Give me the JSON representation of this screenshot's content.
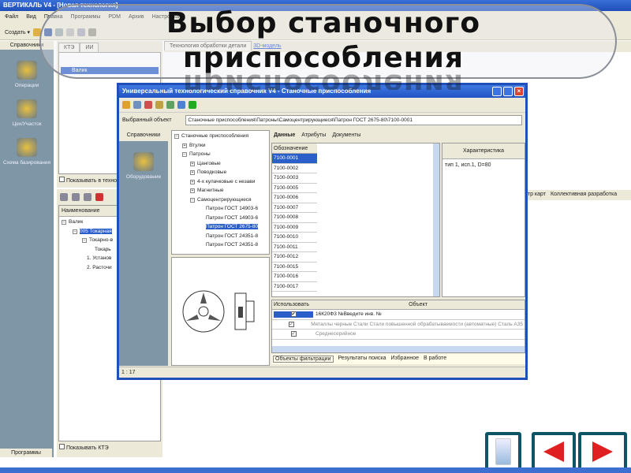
{
  "slide": {
    "title_line1": "Выбор станочного",
    "title_line2": "приспособления"
  },
  "app": {
    "title": "ВЕРТИКАЛЬ V4 - [Новая технология]",
    "menu": [
      "Файл",
      "Вид",
      "Правка",
      "Программы",
      "PDM",
      "Архив",
      "Настройка"
    ],
    "create_label": "Создать",
    "left_header": "Справочники",
    "left_items": [
      "Операции",
      "Цех/Участок",
      "Схема базирования"
    ],
    "left_footer": "Программы",
    "tabs": [
      "КТЭ",
      "ИИ"
    ],
    "tree_root": "Валик",
    "show_in_tech": "Показывать в техно",
    "main_tabs": [
      "Технология обработки детали",
      "3D-модель"
    ],
    "bottom_tabs": [
      "Просмотр карт",
      "Коллективная разработка"
    ],
    "lower_header": "Наименование",
    "lower_tree": [
      "Валик",
      "005 Токарная",
      "Токарно-в",
      "Токарь",
      "1. Установ",
      "2. Расточи"
    ],
    "show_kte": "Показывать КТЭ"
  },
  "dialog": {
    "title": "Универсальный технологический справочник V4 - Станочные приспособления",
    "selected_label": "Выбранный объект",
    "selected_value": "Станочные приспособления\\Патроны\\Самоцентрирующиеся\\Патрон ГОСТ 2675-80\\7100-0001",
    "sidebar_header": "Справочники",
    "sidebar_item": "Оборудование",
    "tree": [
      "Станочные приспособления",
      "Втулки",
      "Патроны",
      "Цанговые",
      "Поводковые",
      "4-х кулачковые с незави",
      "Магнитные",
      "Самоцентрирующиеся",
      "Патрон ГОСТ 14903-6",
      "Патрон ГОСТ 14903-6",
      "Патрон ГОСТ 2675-80",
      "Патрон ГОСТ 24351-8",
      "Патрон ГОСТ 24351-8"
    ],
    "data_tabs": [
      "Данные",
      "Атрибуты",
      "Документы"
    ],
    "col_designation": "Обозначение",
    "designations": [
      "7100-0001",
      "7100-0002",
      "7100-0003",
      "7100-0005",
      "7100-0006",
      "7100-0007",
      "7100-0008",
      "7100-0009",
      "7100-0010",
      "7100-0011",
      "7100-0012",
      "7100-0015",
      "7100-0016",
      "7100-0017"
    ],
    "char_header": "Характеристика",
    "char_value": "тип 1, исп.1, D=80",
    "grid_headers": [
      "Использовать",
      "Объект"
    ],
    "grid_rows": [
      "16К20Ф3 №Введите инв. №",
      "Металлы черные Стали Стали повышенной обрабатываемости (автоматные) Сталь А35",
      "Среднесерийное"
    ],
    "bottom_tabs": [
      "Объекты фильтрации",
      "Результаты поиска",
      "Избранное",
      "В работе"
    ],
    "status": "1 : 17"
  }
}
